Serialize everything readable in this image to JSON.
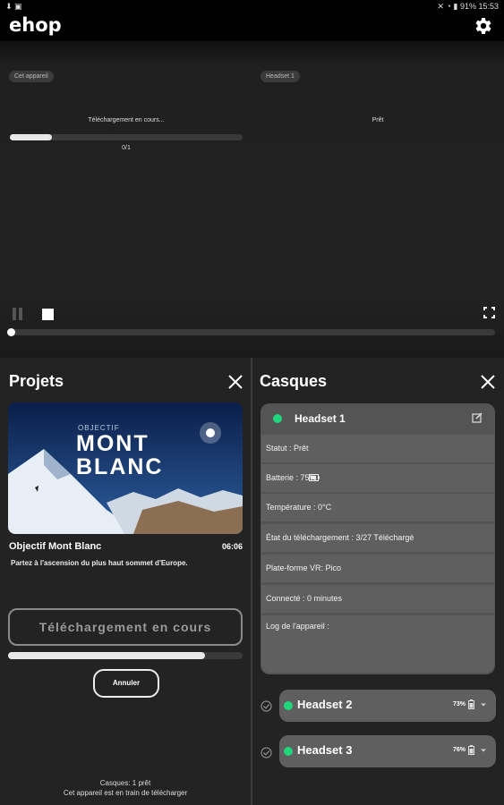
{
  "status_bar": {
    "time": "15:53",
    "battery": "91%"
  },
  "app": {
    "logo": "ehop"
  },
  "player": {
    "left_chip": "Cet appareil",
    "right_chip": "Headset 1",
    "left_status": "Téléchargement en cours...",
    "left_counter": "0/1",
    "right_status": "Prêt",
    "left_progress": 0.18,
    "seek_position": 0
  },
  "projets": {
    "title": "Projets",
    "thumbnail": {
      "pre_title": "OBJECTIF",
      "line1": "MONT",
      "line2": "BLANC"
    },
    "project_title": "Objectif Mont Blanc",
    "duration": "06:06",
    "description": "Partez à l'ascension du plus haut sommet d'Europe.",
    "download_button": "Téléchargement en cours",
    "download_progress": 0.84,
    "cancel_button": "Annuler",
    "footer_line1": "Casques: 1 prêt",
    "footer_line2": "Cet appareil est en train de télécharger"
  },
  "casques": {
    "title": "Casques",
    "headset1": {
      "name": "Headset 1",
      "rows": [
        "Statut :  Prêt",
        "Batterie :     75%",
        "Température :  0°C",
        "État du téléchargement :  3/27 Téléchargé",
        "Plate-forme VR:  Pico",
        "Connecté :  0 minutes",
        "Log de l'appareil :"
      ]
    },
    "headset2": {
      "name": "Headset 2",
      "battery": "73%"
    },
    "headset3": {
      "name": "Headset 3",
      "battery": "76%"
    }
  },
  "colors": {
    "online": "#1fd67b",
    "background": "#232323",
    "card": "#545454"
  }
}
